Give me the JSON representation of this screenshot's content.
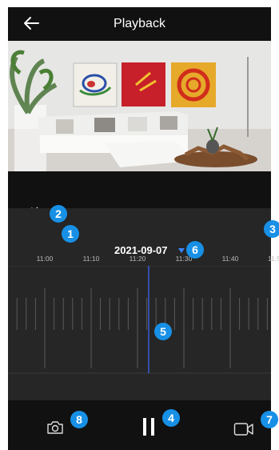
{
  "header": {
    "title": "Playback"
  },
  "timeline": {
    "date": "2021-09-07",
    "tick_labels": [
      "11:00",
      "11:10",
      "11:20",
      "11:30",
      "11:40",
      "11:5"
    ]
  },
  "annotations": [
    "1",
    "2",
    "3",
    "4",
    "5",
    "6",
    "7",
    "8"
  ],
  "colors": {
    "background": "#111111",
    "timeline_bg": "#262626",
    "playhead": "#3a5bd9",
    "badge": "#1790e6"
  }
}
